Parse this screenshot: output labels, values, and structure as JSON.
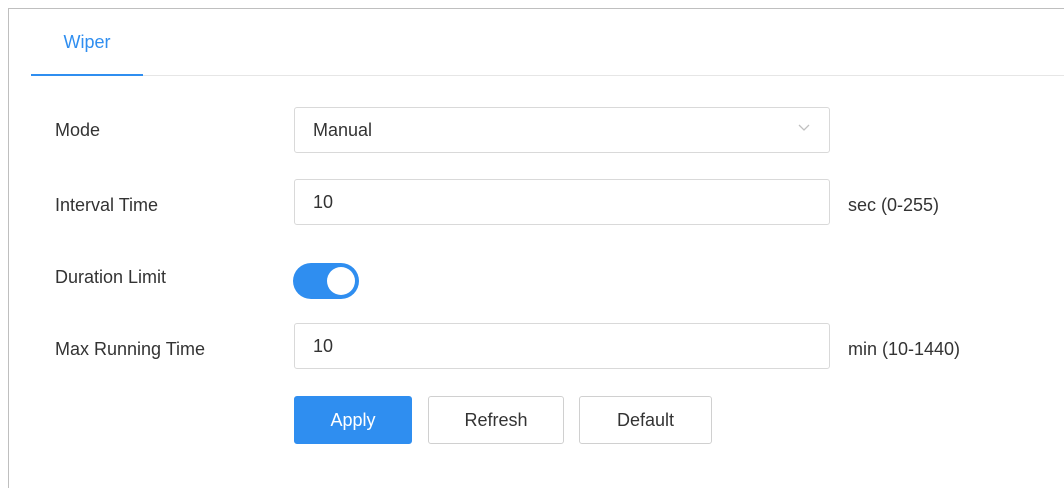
{
  "tabs": [
    {
      "label": "Wiper",
      "active": true
    }
  ],
  "form": {
    "mode": {
      "label": "Mode",
      "value": "Manual"
    },
    "interval_time": {
      "label": "Interval Time",
      "value": "10",
      "unit": "sec (0-255)"
    },
    "duration_limit": {
      "label": "Duration Limit",
      "enabled": true
    },
    "max_running_time": {
      "label": "Max Running Time",
      "value": "10",
      "unit": "min (10-1440)"
    }
  },
  "buttons": {
    "apply": "Apply",
    "refresh": "Refresh",
    "default": "Default"
  },
  "colors": {
    "accent": "#2f8ef0",
    "border": "#d9d9d9",
    "text": "#333333"
  },
  "icons": {
    "select_arrow": "chevron-down-icon"
  }
}
